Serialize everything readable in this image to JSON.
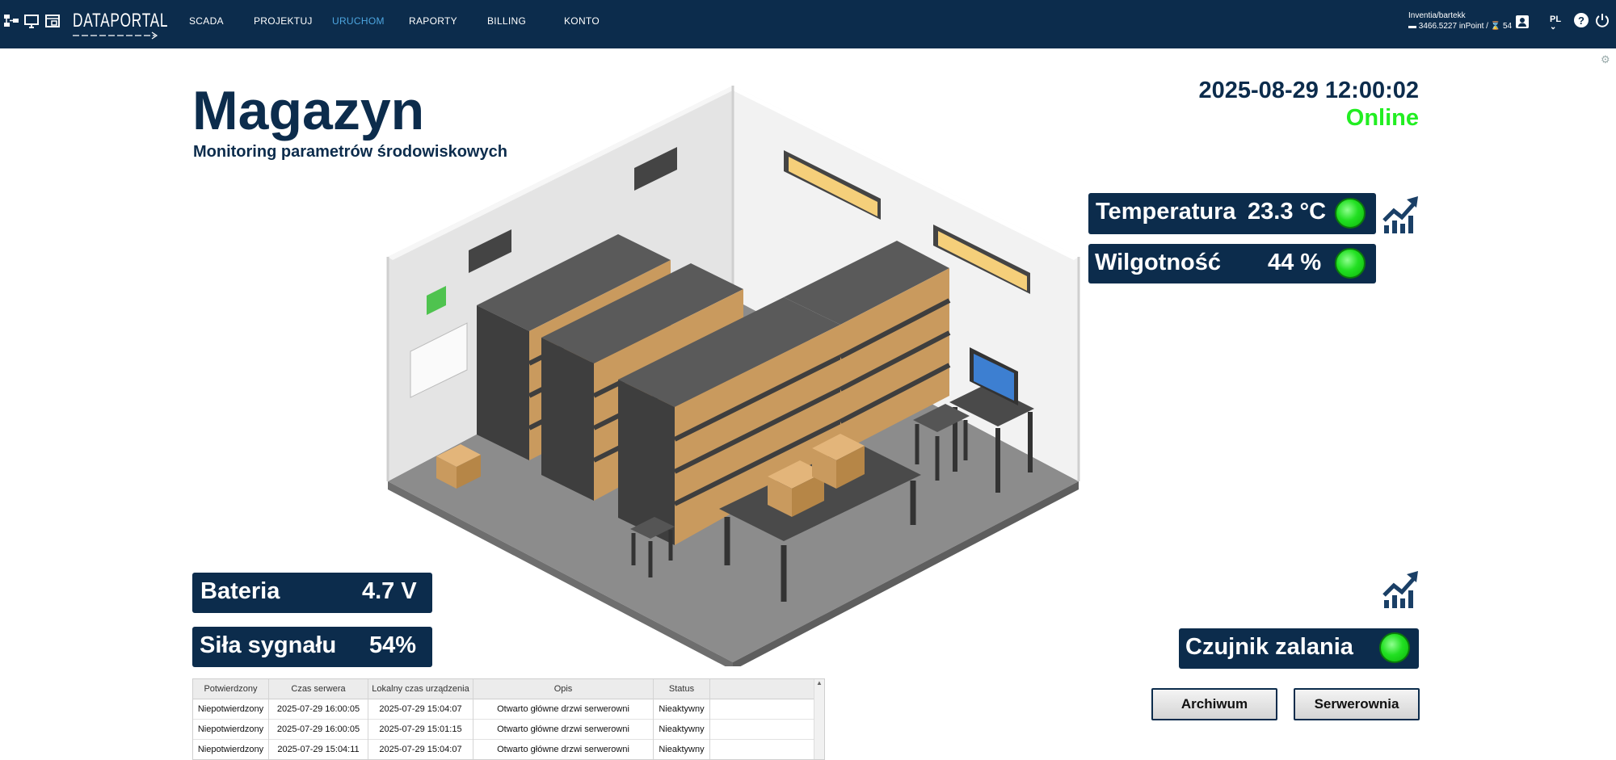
{
  "topbar": {
    "logo_text": "DATAPORTAL",
    "nav": [
      {
        "label": "SCADA",
        "active": false
      },
      {
        "label": "PROJEKTUJ",
        "active": false
      },
      {
        "label": "URUCHOM",
        "active": true
      },
      {
        "label": "RAPORTY",
        "active": false
      },
      {
        "label": "BILLING",
        "active": false
      },
      {
        "label": "KONTO",
        "active": false
      }
    ],
    "account": {
      "user": "Inventia/bartekk",
      "balance": "3466.5227 inPoint /",
      "count": "54"
    },
    "language": "PL"
  },
  "page": {
    "title": "Magazyn",
    "subtitle": "Monitoring parametrów środowiskowych",
    "datetime": "2025-08-29 12:00:02",
    "status": "Online"
  },
  "sensors": {
    "temperature": {
      "label": "Temperatura",
      "value": "23.3 °C"
    },
    "humidity": {
      "label": "Wilgotność",
      "value": "44 %"
    },
    "battery": {
      "label": "Bateria",
      "value": "4.7 V"
    },
    "signal": {
      "label": "Siła sygnału",
      "value": "54%"
    },
    "flood": {
      "label": "Czujnik zalania"
    }
  },
  "buttons": {
    "archive": "Archiwum",
    "server_room": "Serwerownia"
  },
  "alarm_table": {
    "columns": [
      "Potwierdzony",
      "Czas serwera",
      "Lokalny czas urządzenia",
      "Opis",
      "Status"
    ],
    "rows": [
      [
        "Niepotwierdzony",
        "2025-07-29 16:00:05",
        "2025-07-29 15:04:07",
        "Otwarto główne drzwi serwerowni",
        "Nieaktywny"
      ],
      [
        "Niepotwierdzony",
        "2025-07-29 16:00:05",
        "2025-07-29 15:01:15",
        "Otwarto główne drzwi serwerowni",
        "Nieaktywny"
      ],
      [
        "Niepotwierdzony",
        "2025-07-29 15:04:11",
        "2025-07-29 15:04:07",
        "Otwarto główne drzwi serwerowni",
        "Nieaktywny"
      ]
    ]
  },
  "colors": {
    "primary": "#0c2c4c",
    "online": "#22ee22",
    "led_green": "#22e022",
    "nav_active": "#4da6e0"
  },
  "icons": [
    "network-icon",
    "monitor-icon",
    "window-icon",
    "user-icon",
    "help-icon",
    "power-icon",
    "trend-chart-icon",
    "gear-icon",
    "hourglass-icon",
    "wallet-icon"
  ]
}
